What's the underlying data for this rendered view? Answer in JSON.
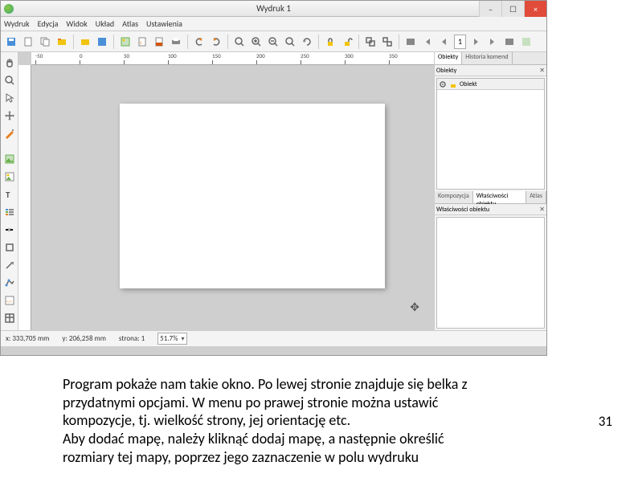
{
  "window": {
    "title": "Wydruk 1",
    "minimize": "–",
    "maximize": "☐",
    "close": "×"
  },
  "menubar": [
    "Wydruk",
    "Edycja",
    "Widok",
    "Układ",
    "Atlas",
    "Ustawienia"
  ],
  "toolbar": {
    "page_value": "1"
  },
  "ruler": {
    "ticks": [
      "-50",
      "0",
      "50",
      "100",
      "150",
      "200",
      "250",
      "300",
      "350"
    ]
  },
  "right_panel": {
    "top_tabs": [
      "Obiekty",
      "Historia komend"
    ],
    "top_title": "Obiekty",
    "top_col": "Obiekt",
    "mid_tabs": [
      "Kompozycja",
      "Właściwości obiektu",
      "Atlas"
    ],
    "bottom_title": "Właściwości obiektu"
  },
  "statusbar": {
    "x": "x: 333,705 mm",
    "y": "y: 206,258 mm",
    "page": "strona: 1",
    "zoom": "51.7%"
  },
  "caption": {
    "line1": "Program pokaże nam takie okno. Po lewej stronie znajduje się belka z",
    "line2": "przydatnymi opcjami. W menu po prawej stronie można ustawić",
    "line3": "kompozycje, tj. wielkość strony, jej orientację etc.",
    "line4": "Aby dodać mapę, należy kliknąć dodaj mapę, a następnie określić",
    "line5": "rozmiary tej mapy, poprzez jego zaznaczenie w polu wydruku"
  },
  "page_num": "31"
}
